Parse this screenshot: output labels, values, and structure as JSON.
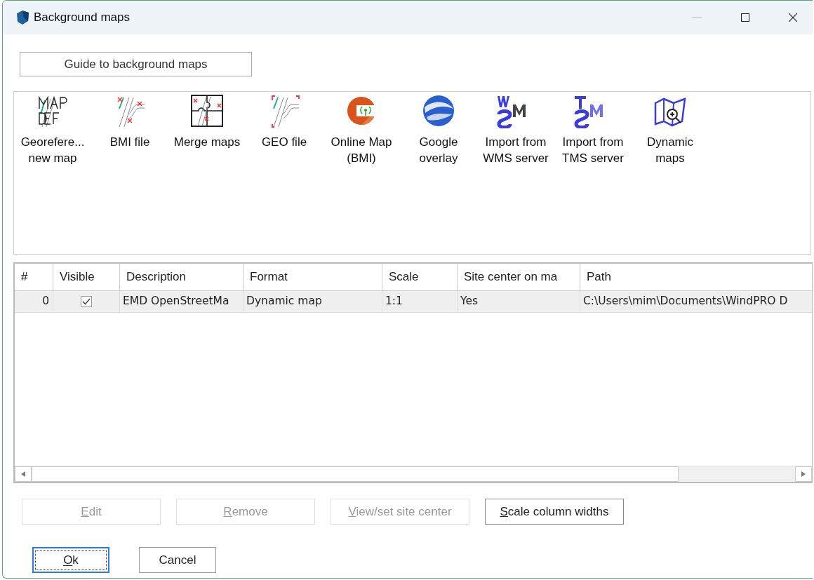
{
  "window": {
    "title": "Background maps"
  },
  "guide_button": {
    "label": "Guide to background maps"
  },
  "tools": [
    {
      "kind": "mapdef",
      "label": "Georefere... new map"
    },
    {
      "kind": "bmi",
      "label": "BMI file"
    },
    {
      "kind": "merge",
      "label": "Merge maps"
    },
    {
      "kind": "geo",
      "label": "GEO file"
    },
    {
      "kind": "online",
      "label": "Online Map (BMI)"
    },
    {
      "kind": "globe",
      "label": "Google overlay"
    },
    {
      "kind": "wms",
      "label": "Import from WMS server"
    },
    {
      "kind": "tms",
      "label": "Import from TMS server"
    },
    {
      "kind": "dynamic",
      "label": "Dynamic maps"
    }
  ],
  "table": {
    "columns": [
      "#",
      "Visible",
      "Description",
      "Format",
      "Scale",
      "Site center on ma",
      "Path"
    ],
    "rows": [
      {
        "number": "0",
        "visible": true,
        "description": "EMD OpenStreetMa",
        "format": "Dynamic map",
        "scale": "1:1",
        "site_center": "Yes",
        "path": "C:\\Users\\mim\\Documents\\WindPRO D",
        "selected": true
      }
    ]
  },
  "actions": [
    {
      "label": "Edit",
      "disabled": true
    },
    {
      "label": "Remove",
      "disabled": true
    },
    {
      "label": "View/set site center",
      "disabled": true
    },
    {
      "label": "Scale column widths",
      "disabled": false
    }
  ],
  "footer_buttons": [
    {
      "label": "Ok",
      "default": true
    },
    {
      "label": "Cancel",
      "default": false
    }
  ]
}
